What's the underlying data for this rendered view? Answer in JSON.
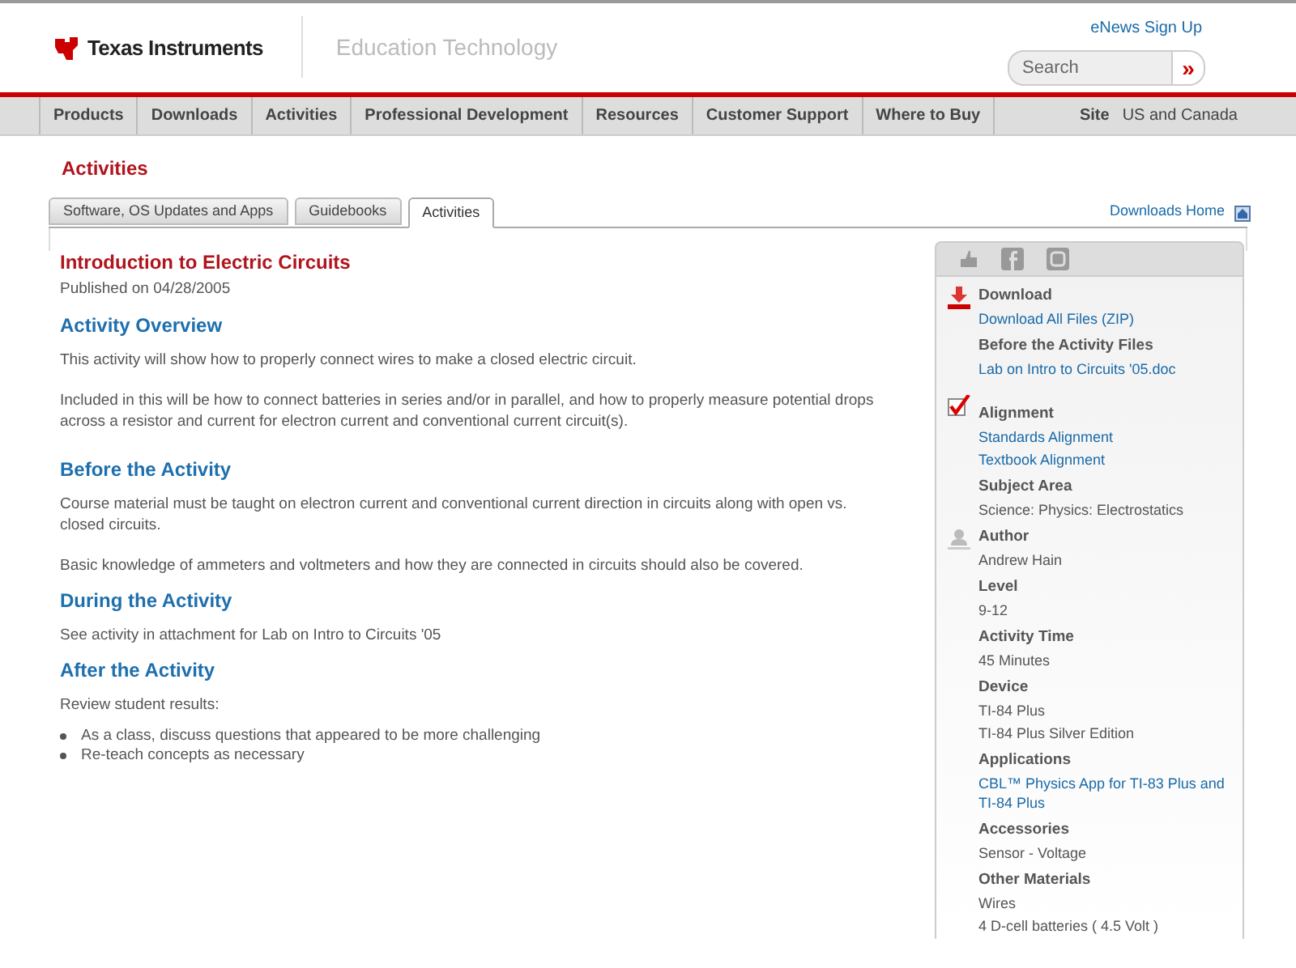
{
  "header": {
    "brand": "Texas Instruments",
    "section": "Education Technology",
    "enews_link": "eNews Sign Up",
    "search": {
      "placeholder": "Search",
      "button": "»"
    }
  },
  "nav": {
    "items": [
      "Products",
      "Downloads",
      "Activities",
      "Professional Development",
      "Resources",
      "Customer Support",
      "Where to Buy"
    ],
    "site_label": "Site",
    "site_value": "US and Canada"
  },
  "page_title": "Activities",
  "tabs": [
    {
      "label": "Software, OS Updates and Apps",
      "selected": false
    },
    {
      "label": "Guidebooks",
      "selected": false
    },
    {
      "label": "Activities",
      "selected": true
    }
  ],
  "downloads_home": "Downloads Home",
  "article": {
    "title": "Introduction to Electric Circuits",
    "published": "Published on 04/28/2005",
    "sections": [
      {
        "heading": "Activity Overview",
        "paragraphs": [
          "This activity will show how to properly connect wires to make a closed electric circuit.",
          "Included in this will be how to connect batteries in series and/or in parallel, and how to properly measure potential drops across a resistor and current for electron current and conventional current circuit(s)."
        ]
      },
      {
        "heading": "Before the Activity",
        "paragraphs": [
          "Course material must be taught on electron current and conventional current direction in circuits along with open vs. closed circuits.",
          "Basic knowledge of ammeters and voltmeters and how they are connected in circuits should also be covered."
        ]
      },
      {
        "heading": "During the Activity",
        "paragraphs": [
          "See activity in attachment for Lab on Intro to Circuits '05"
        ]
      },
      {
        "heading": "After the Activity",
        "paragraphs": [
          "Review student results:"
        ],
        "bullets": [
          "As a class, discuss questions that appeared to be more challenging",
          "Re-teach concepts as necessary"
        ]
      }
    ]
  },
  "sidebar": {
    "sections": [
      {
        "heading": "Download",
        "links": [
          "Download All Files (ZIP)"
        ]
      },
      {
        "heading": "Before the Activity Files",
        "links": [
          "Lab on Intro to Circuits '05.doc"
        ]
      },
      {
        "heading": "Alignment",
        "links": [
          "Standards Alignment",
          "Textbook Alignment"
        ]
      },
      {
        "heading": "Subject Area",
        "texts": [
          "Science: Physics: Electrostatics"
        ]
      },
      {
        "heading": "Author",
        "texts": [
          "Andrew Hain"
        ]
      },
      {
        "heading": "Level",
        "texts": [
          "9-12"
        ]
      },
      {
        "heading": "Activity Time",
        "texts": [
          "45 Minutes"
        ]
      },
      {
        "heading": "Device",
        "texts": [
          "TI-84 Plus",
          "TI-84 Plus Silver Edition"
        ]
      },
      {
        "heading": "Applications",
        "links": [
          "CBL™ Physics App for TI-83 Plus and TI-84 Plus"
        ]
      },
      {
        "heading": "Accessories",
        "texts": [
          "Sensor - Voltage"
        ]
      },
      {
        "heading": "Other Materials",
        "texts": [
          "Wires",
          "4 D-cell batteries ( 4.5 Volt )"
        ]
      }
    ]
  }
}
